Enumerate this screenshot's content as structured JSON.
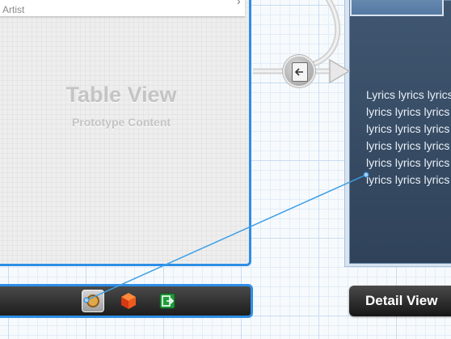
{
  "table_scene": {
    "cell_subtitle": "Artist",
    "placeholder_title": "Table View",
    "placeholder_subtitle": "Prototype Content"
  },
  "dock": {
    "icons": [
      "view-controller-icon",
      "first-responder-icon",
      "exit-icon"
    ]
  },
  "segue": {
    "icon": "push-segue-icon"
  },
  "detail_scene": {
    "lyrics_lines": [
      "Lyrics lyrics lyrics",
      "lyrics lyrics lyrics",
      "lyrics lyrics lyrics",
      "lyrics lyrics lyrics",
      "lyrics lyrics lyrics",
      "lyrics lyrics lyrics"
    ],
    "scene_label": "Detail View"
  },
  "colors": {
    "selection_blue": "#2e8ee6",
    "detail_background": "#34475e"
  }
}
